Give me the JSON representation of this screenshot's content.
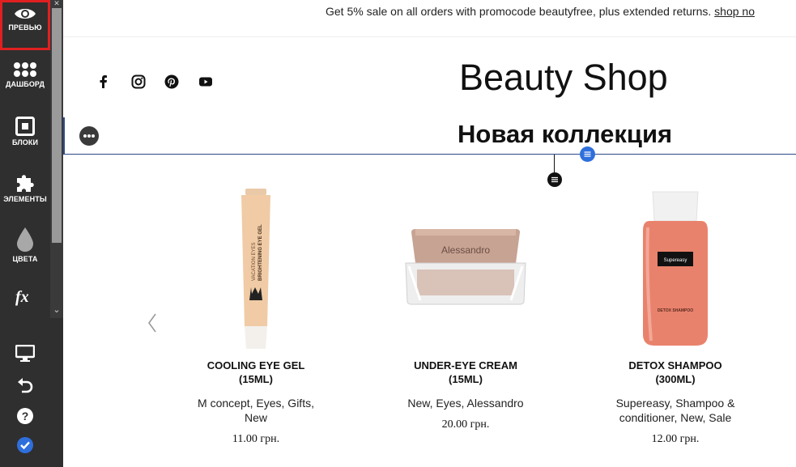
{
  "sidebar": {
    "items": [
      {
        "label": "ПРЕВЬЮ",
        "icon": "eye-icon",
        "active": true
      },
      {
        "label": "ДАШБОРД",
        "icon": "dots-grid-icon"
      },
      {
        "label": "БЛОКИ",
        "icon": "block-icon"
      },
      {
        "label": "ЭЛЕМЕНТЫ",
        "icon": "puzzle-icon"
      },
      {
        "label": "ЦВЕТА",
        "icon": "drop-icon"
      },
      {
        "label": "",
        "icon": "function-icon"
      }
    ],
    "bottom_icons": [
      "monitor-icon",
      "undo-icon",
      "help-icon",
      "check-badge-icon"
    ]
  },
  "promo": {
    "text": "Get 5% sale on all orders with promocode beautyfree, plus extended returns. ",
    "link": "shop no"
  },
  "social_icons": [
    "facebook-icon",
    "instagram-icon",
    "pinterest-icon",
    "youtube-icon"
  ],
  "header": {
    "title": "Beauty Shop"
  },
  "section": {
    "title": "Новая коллекция"
  },
  "products": [
    {
      "name": "COOLING EYE GEL\n(15ML)",
      "tags": "M concept, Eyes, Gifts,\nNew",
      "price": "11.00 грн."
    },
    {
      "name": "UNDER-EYE CREAM\n(15ML)",
      "tags": "New, Eyes, Alessandro",
      "price": "20.00 грн.",
      "brand_on_jar": "Alessandro"
    },
    {
      "name": "DETOX SHAMPOO\n(300ML)",
      "tags": "Supereasy, Shampoo &\nconditioner, New, Sale",
      "price": "12.00 грн.",
      "brand_on_bottle": "Supereasy",
      "bottle_text": "DETOX SHAMPOO"
    }
  ],
  "colors": {
    "sidebar_bg": "#2f2f2f",
    "active_outline": "#e02020",
    "selection": "#2b4a8a",
    "handle_blue": "#2f6fdc"
  }
}
